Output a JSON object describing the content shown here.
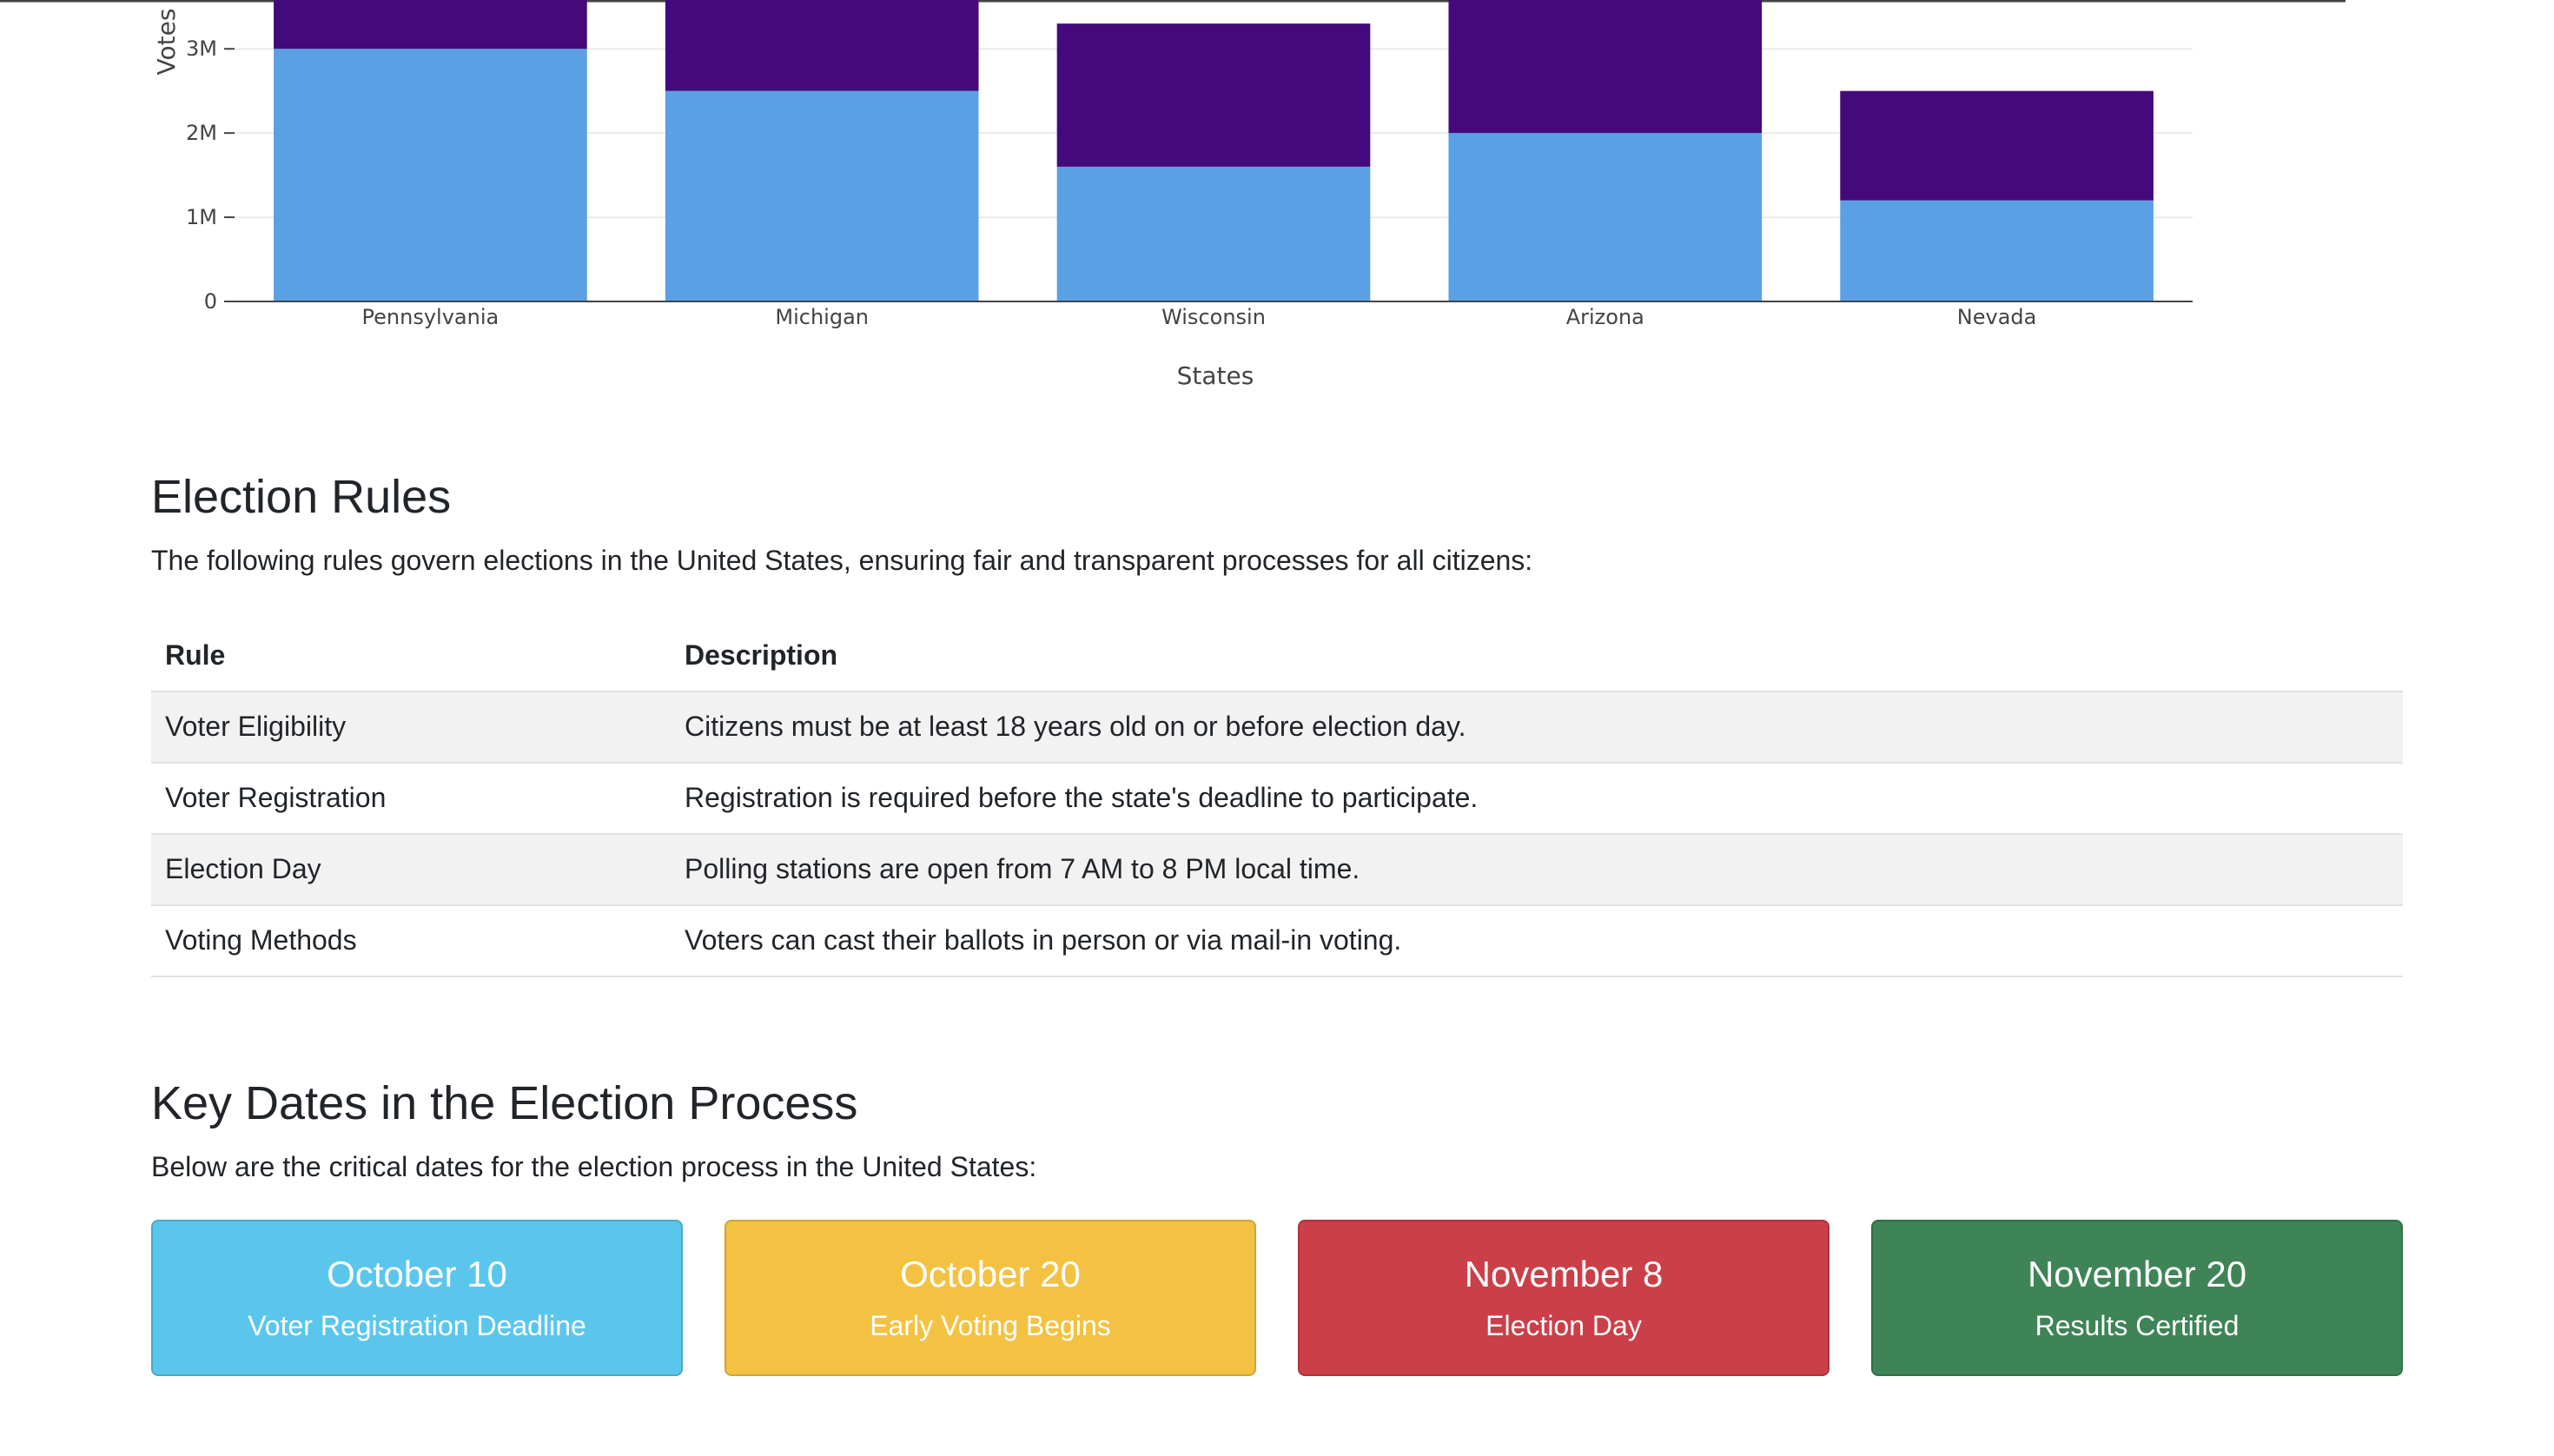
{
  "chart_data": {
    "type": "bar",
    "stacked": true,
    "categories": [
      "Pennsylvania",
      "Michigan",
      "Wisconsin",
      "Arizona",
      "Nevada"
    ],
    "series": [
      {
        "color": "#5aa0e4",
        "values": [
          3000000,
          2500000,
          1600000,
          2000000,
          1200000
        ]
      },
      {
        "color": "#440a7b",
        "values": [
          3000000,
          2500000,
          1700000,
          2400000,
          1300000
        ]
      }
    ],
    "xlabel": "States",
    "ylabel": "Votes",
    "y_ticks": [
      0,
      1000000,
      2000000,
      3000000
    ],
    "y_tick_labels": [
      "0",
      "1M",
      "2M",
      "3M"
    ],
    "ylim": [
      0,
      3580000
    ],
    "grid": true
  },
  "rules": {
    "title": "Election Rules",
    "intro": "The following rules govern elections in the United States, ensuring fair and transparent processes for all citizens:",
    "headers": {
      "rule": "Rule",
      "description": "Description"
    },
    "rows": [
      {
        "rule": "Voter Eligibility",
        "description": "Citizens must be at least 18 years old on or before election day."
      },
      {
        "rule": "Voter Registration",
        "description": "Registration is required before the state's deadline to participate."
      },
      {
        "rule": "Election Day",
        "description": "Polling stations are open from 7 AM to 8 PM local time."
      },
      {
        "rule": "Voting Methods",
        "description": "Voters can cast their ballots in person or via mail-in voting."
      }
    ]
  },
  "dates": {
    "title": "Key Dates in the Election Process",
    "intro": "Below are the critical dates for the election process in the United States:",
    "cards": [
      {
        "date": "October 10",
        "label": "Voter Registration Deadline",
        "color": "#5bc6ec"
      },
      {
        "date": "October 20",
        "label": "Early Voting Begins",
        "color": "#f3c242"
      },
      {
        "date": "November 8",
        "label": "Election Day",
        "color": "#cb3f48"
      },
      {
        "date": "November 20",
        "label": "Results Certified",
        "color": "#3e8456"
      }
    ]
  }
}
